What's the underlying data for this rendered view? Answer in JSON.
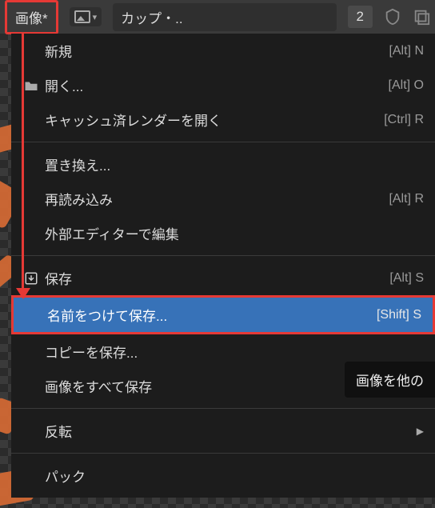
{
  "topbar": {
    "image_menu_label": "画像*",
    "name_field": "カップ・..",
    "user_count": "2"
  },
  "menu": {
    "new": {
      "label": "新規",
      "shortcut": "[Alt] N"
    },
    "open": {
      "label": "開く...",
      "shortcut": "[Alt] O"
    },
    "open_cached": {
      "label": "キャッシュ済レンダーを開く",
      "shortcut": "[Ctrl] R"
    },
    "replace": {
      "label": "置き換え...",
      "shortcut": ""
    },
    "reload": {
      "label": "再読み込み",
      "shortcut": "[Alt] R"
    },
    "edit_external": {
      "label": "外部エディターで編集",
      "shortcut": ""
    },
    "save": {
      "label": "保存",
      "shortcut": "[Alt] S"
    },
    "save_as": {
      "label": "名前をつけて保存...",
      "shortcut": "[Shift] S"
    },
    "save_copy": {
      "label": "コピーを保存...",
      "shortcut": ""
    },
    "save_all": {
      "label": "画像をすべて保存",
      "shortcut": ""
    },
    "invert": {
      "label": "反転",
      "shortcut": ""
    },
    "pack": {
      "label": "パック",
      "shortcut": ""
    }
  },
  "tooltip": {
    "text": "画像を他の"
  }
}
